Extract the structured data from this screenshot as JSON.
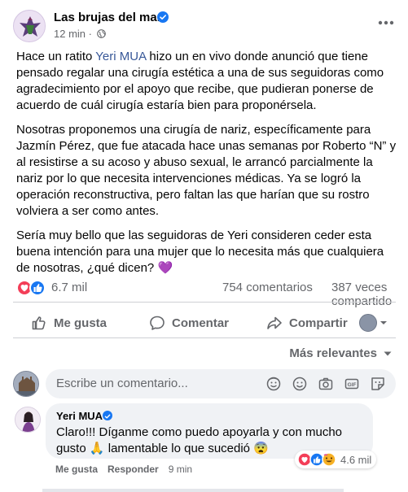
{
  "post": {
    "page_name": "Las brujas del mar",
    "time": "12 min",
    "paragraphs": [
      {
        "before": "Hace un ratito ",
        "mention": "Yeri MUA",
        "after": " hizo un en vivo donde anunció que tiene pensado regalar una cirugía estética a una de sus seguidoras como agradecimiento por el apoyo que recibe, que pudieran ponerse de acuerdo de cuál cirugía estaría bien para proponérsela."
      },
      {
        "text": "Nosotras proponemos una cirugía de nariz, específicamente para Jazmín Pérez, que fue atacada hace unas semanas por Roberto “N” y al resistirse a su acoso y abuso sexual, le arrancó parcialmente la nariz por lo que necesita intervenciones médicas. Ya se logró la operación reconstructiva, pero faltan las que harían que su rostro volviera a ser como antes."
      },
      {
        "text": "Sería muy bello que las seguidoras de Yeri consideren ceder esta buena intención para una mujer que lo necesita más que cualquiera de nosotras, ¿qué dicen? ",
        "emoji": "💜"
      }
    ]
  },
  "stats": {
    "reactions": "6.7 mil",
    "comments": "754 comentarios",
    "shares": "387 veces compartido"
  },
  "actions": {
    "like": "Me gusta",
    "comment": "Comentar",
    "share": "Compartir"
  },
  "sort_label": "Más relevantes",
  "composer": {
    "placeholder": "Escribe un comentario..."
  },
  "comment": {
    "author": "Yeri MUA",
    "text_line1": "Claro!!! Díganme como puedo apoyarla y con mucho",
    "text_line2_a": "gusto ",
    "text_line2_emoji": "🙏",
    "text_line2_b": " lamentable lo que sucedió ",
    "text_line2_emoji2": "😨",
    "reaction_count": "4.6 mil",
    "like_label": "Me gusta",
    "reply_label": "Responder",
    "time": "9 min"
  },
  "colors": {
    "primary_text": "#050505",
    "secondary_text": "#65676b",
    "brand_blue": "#1877f2",
    "like_blue": "#1877f2",
    "love_red": "#f33e58",
    "bubble_bg": "#f0f2f5",
    "mention": "#385898"
  },
  "icons": [
    "globe-icon",
    "more-icon",
    "like-icon",
    "love-icon",
    "haha-icon",
    "comment-icon",
    "share-icon",
    "chevron-down-icon",
    "sticker-icon",
    "emoji-icon",
    "camera-icon",
    "gif-icon",
    "avatar-sticker-icon",
    "verified-icon"
  ]
}
